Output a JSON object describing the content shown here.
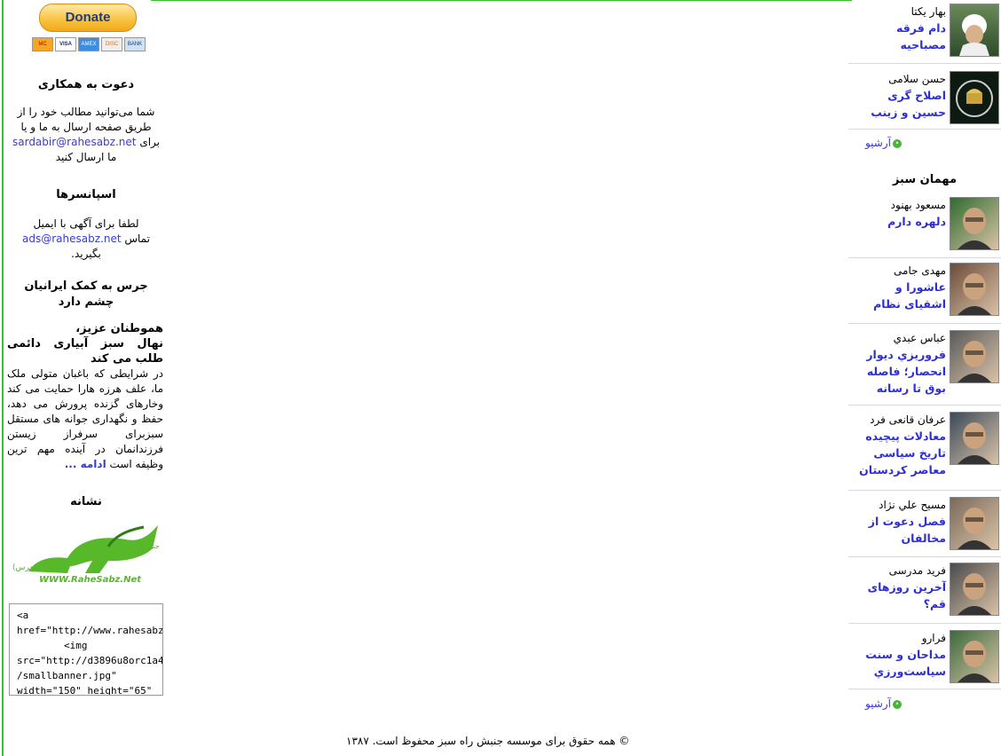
{
  "donate": {
    "label": "Donate",
    "cards": [
      "MC",
      "VISA",
      "AMEX",
      "DISC",
      "BANK"
    ]
  },
  "invite": {
    "title": "دعوت به همکاری",
    "line1": "شما می‌توانید مطالب خود را از",
    "line2": "طریق صفحه ارسال به ما و یا",
    "email": "sardabir@rahesabz.net",
    "line3_suffix": "برای",
    "line4": "ما ارسال کنید"
  },
  "sponsors": {
    "title": "اسپانسرها",
    "line1": "لطفا برای آگهی با ایمیل",
    "email": "ads@rahesabz.net",
    "line2_suffix": "تماس",
    "line3": "بگیرید."
  },
  "help": {
    "title_line1": "جرس به کمک ایرانیان",
    "title_line2": "چشم دارد",
    "salutation": "هموطنان عزیز،",
    "headline": "نهال سبز آبیاری دائمی طلب می کند",
    "body": "در شرایطی که باغبان متولی ملک ما، علف هرزه هارا حمایت می کند وخارهای گزنده پرورش می دهد، حفظ و نگهداری جوانه های مستقل سبزبرای سرفراز زیستن فرزندانمان در آینده مهم ترین وظیفه است",
    "more": "ادامه ..."
  },
  "badge": {
    "title": "نشانه",
    "logo_text": "راه سبز",
    "logo_sub": "جنبش",
    "logo_url": "WWW.RaheSabz.Net",
    "logo_tag": "(جرس)"
  },
  "embed_code": {
    "lines": [
      "<a",
      "href=\"http://www.rahesabz",
      "        <img",
      "src=\"http://d3896u8orc1a4!",
      "/smallbanner.jpg\"",
      "width=\"150\" height=\"65\""
    ]
  },
  "authors_top": [
    {
      "name": "بهار یکتا",
      "title_lines": [
        "دام فرقه",
        "مصباحیه"
      ],
      "icon": "cleric-photo"
    },
    {
      "name": "حسن سلامی",
      "title_lines": [
        "اصلاح گری",
        "حسین و زینب"
      ],
      "icon": "shrine-photo"
    }
  ],
  "archive_label": "آرشیو",
  "guest_title": "مهمان سبز",
  "guests": [
    {
      "name": "مسعود بهنود",
      "title_lines": [
        "دلهره دارم"
      ],
      "icon": "portrait-photo"
    },
    {
      "name": "مهدی جامی",
      "title_lines": [
        "عاشورا و",
        "اشقیای نظام"
      ],
      "icon": "portrait-photo"
    },
    {
      "name": "عباس عبدي",
      "title_lines": [
        "فروريزي ديوار",
        "انحصار؛ فاصله",
        "بوق تا رسانه"
      ],
      "icon": "portrait-photo"
    },
    {
      "name": "عرفان قانعی فرد",
      "title_lines": [
        "معادلات پیچیده",
        "تاریخ سیاسی",
        "معاصر کردستان"
      ],
      "icon": "portrait-photo"
    },
    {
      "name": "مسیح علي نژاد",
      "title_lines": [
        "فصل دعوت از",
        "مخالفان"
      ],
      "icon": "portrait-photo"
    },
    {
      "name": "فرید مدرسی",
      "title_lines": [
        "آخرین روزهای",
        "قم؟"
      ],
      "icon": "portrait-photo"
    },
    {
      "name": "فرارو",
      "title_lines": [
        "مداحان و سنت",
        "سیاست‌ورزي"
      ],
      "icon": "portrait-photo"
    }
  ],
  "footer": "© همه حقوق برای موسسه جنبش راه سبز محفوظ است. ۱۳۸۷",
  "colors": {
    "accent_green": "#3cbf30",
    "link_blue": "#2e2ed6"
  }
}
